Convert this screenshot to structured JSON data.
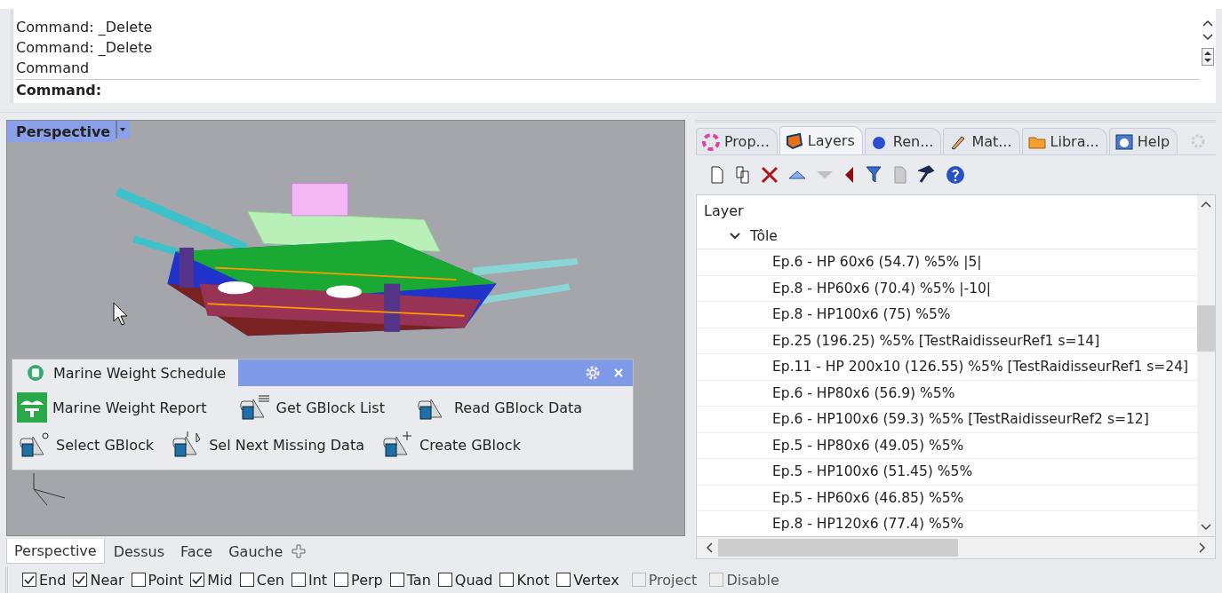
{
  "command_window": {
    "history": [
      "Command: _Delete",
      "Command: _Delete",
      "Command"
    ],
    "prompt": "Command:"
  },
  "viewport": {
    "title": "Perspective"
  },
  "floating_toolbar": {
    "title": "Marine Weight Schedule",
    "buttons": [
      {
        "label": "Marine Weight Report"
      },
      {
        "label": "Get GBlock List"
      },
      {
        "label": "Read GBlock Data"
      },
      {
        "label": "Select GBlock"
      },
      {
        "label": "Sel Next Missing Data"
      },
      {
        "label": "Create GBlock"
      }
    ]
  },
  "panel_tabs": [
    {
      "label": "Prop...",
      "selected": false
    },
    {
      "label": "Layers",
      "selected": true
    },
    {
      "label": "Ren...",
      "selected": false
    },
    {
      "label": "Mat...",
      "selected": false
    },
    {
      "label": "Libra...",
      "selected": false
    },
    {
      "label": "Help",
      "selected": false
    }
  ],
  "layers": {
    "header": "Layer",
    "items": [
      {
        "name": "Tôle",
        "expanded": true,
        "children": [
          {
            "name": "Ep.6 - HP 60x6 (54.7) %5% |5|"
          },
          {
            "name": "Ep.8 - HP60x6 (70.4) %5% |-10|"
          },
          {
            "name": "Ep.8 - HP100x6 (75) %5%"
          },
          {
            "name": "Ep.25 (196.25) %5% [TestRaidisseurRef1 s=14]"
          },
          {
            "name": "Ep.11 - HP 200x10 (126.55) %5% [TestRaidisseurRef1 s=24]"
          },
          {
            "name": "Ep.6 - HP80x6 (56.9) %5%"
          },
          {
            "name": "Ep.6 - HP100x6 (59.3) %5% [TestRaidisseurRef2 s=12]"
          },
          {
            "name": "Ep.5 - HP80x6 (49.05) %5%"
          },
          {
            "name": "Ep.5 - HP100x6 (51.45) %5%"
          },
          {
            "name": "Ep.5 - HP60x6 (46.85) %5%"
          },
          {
            "name": "Ep.8 - HP120x6 (77.4) %5%"
          }
        ]
      }
    ]
  },
  "viewport_tabs": [
    {
      "label": "Perspective",
      "selected": true
    },
    {
      "label": "Dessus",
      "selected": false
    },
    {
      "label": "Face",
      "selected": false
    },
    {
      "label": "Gauche",
      "selected": false
    }
  ],
  "osnaps": [
    {
      "label": "End",
      "checked": true,
      "disabled": false
    },
    {
      "label": "Near",
      "checked": true,
      "disabled": false
    },
    {
      "label": "Point",
      "checked": false,
      "disabled": false
    },
    {
      "label": "Mid",
      "checked": true,
      "disabled": false
    },
    {
      "label": "Cen",
      "checked": false,
      "disabled": false
    },
    {
      "label": "Int",
      "checked": false,
      "disabled": false
    },
    {
      "label": "Perp",
      "checked": false,
      "disabled": false
    },
    {
      "label": "Tan",
      "checked": false,
      "disabled": false
    },
    {
      "label": "Quad",
      "checked": false,
      "disabled": false
    },
    {
      "label": "Knot",
      "checked": false,
      "disabled": false
    },
    {
      "label": "Vertex",
      "checked": false,
      "disabled": false
    },
    {
      "label": "Project",
      "checked": false,
      "disabled": true
    },
    {
      "label": "Disable",
      "checked": false,
      "disabled": true
    }
  ]
}
